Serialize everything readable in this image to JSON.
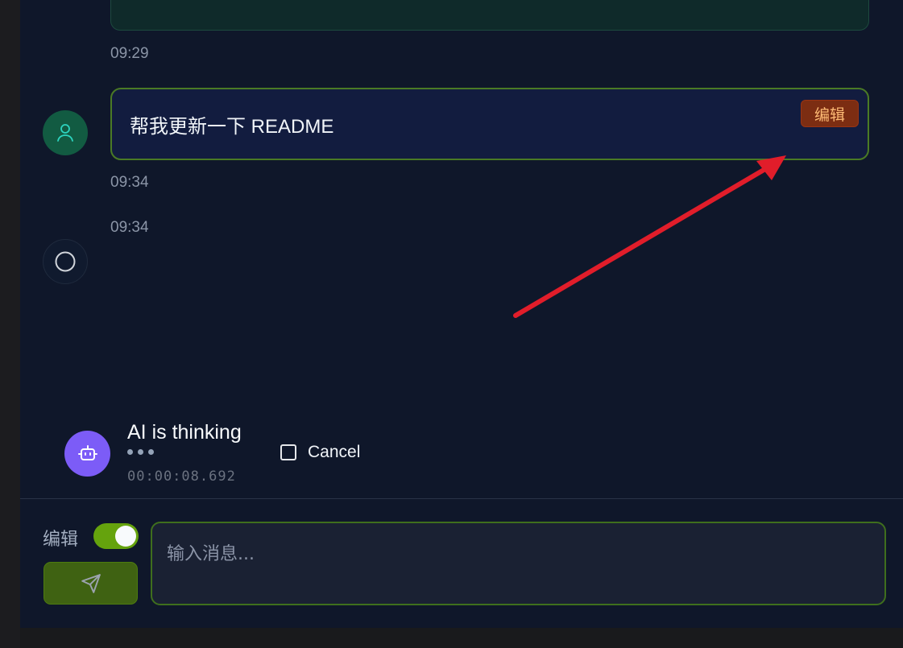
{
  "messages": {
    "prev_time": "09:29",
    "user_message": {
      "text": "帮我更新一下 README",
      "edit_label": "编辑",
      "time": "09:34"
    },
    "ai_message": {
      "time": "09:34"
    }
  },
  "thinking": {
    "title": "AI is thinking",
    "elapsed": "00:00:08.692",
    "cancel_label": "Cancel"
  },
  "composer": {
    "edit_label": "编辑",
    "edit_toggle_on": true,
    "placeholder": "输入消息..."
  },
  "colors": {
    "accent_green": "#4a7a25",
    "annotation_arrow": "#e11d2a",
    "bot_avatar": "#7c5cf7"
  },
  "icons": {
    "user_avatar": "user-icon",
    "ai_avatar": "circle-icon",
    "bot_avatar": "bot-icon",
    "send": "send-icon"
  }
}
